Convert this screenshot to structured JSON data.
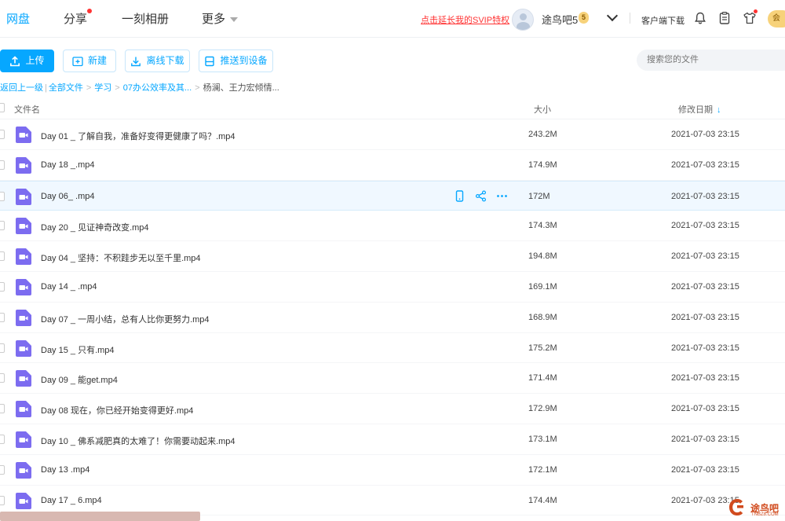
{
  "nav": {
    "tabs": [
      {
        "label": "网盘",
        "active": true
      },
      {
        "label": "分享",
        "badge_dot": true
      },
      {
        "label": "一刻相册"
      },
      {
        "label": "更多"
      }
    ],
    "svip_link": "点击延长我的SVIP特权",
    "username": "途鸟吧5",
    "vip_level": "5",
    "client_download": "客户端下载",
    "right_chip": "会"
  },
  "toolbar": {
    "upload": "上传",
    "new": "新建",
    "offline_download": "离线下载",
    "push_to_device": "推送到设备",
    "search_placeholder": "搜索您的文件"
  },
  "breadcrumb": {
    "back": "返回上一级",
    "items": [
      "全部文件",
      "学习",
      "07办公效率及其...",
      "杨澜、王力宏倾情..."
    ]
  },
  "table": {
    "col_name": "文件名",
    "col_size": "大小",
    "col_date": "修改日期",
    "rows": [
      {
        "name": "Day 01 _ 了解自我，准备好变得更健康了吗？.mp4",
        "size": "243.2M",
        "date": "2021-07-03 23:15"
      },
      {
        "name": "Day 18 _.mp4",
        "size": "174.9M",
        "date": "2021-07-03 23:15"
      },
      {
        "name": "Day 06_ .mp4",
        "size": "172M",
        "date": "2021-07-03 23:15",
        "hover": true
      },
      {
        "name": "Day 20 _ 见证神奇改变.mp4",
        "size": "174.3M",
        "date": "2021-07-03 23:15"
      },
      {
        "name": "Day 04 _ 坚持：不积跬步无以至千里.mp4",
        "size": "194.8M",
        "date": "2021-07-03 23:15"
      },
      {
        "name": "Day 14 _ .mp4",
        "size": "169.1M",
        "date": "2021-07-03 23:15"
      },
      {
        "name": "Day 07 _ 一周小结，总有人比你更努力.mp4",
        "size": "168.9M",
        "date": "2021-07-03 23:15"
      },
      {
        "name": "Day 15 _ 只有.mp4",
        "size": "175.2M",
        "date": "2021-07-03 23:15"
      },
      {
        "name": "Day 09 _ 能get.mp4",
        "size": "171.4M",
        "date": "2021-07-03 23:15"
      },
      {
        "name": "Day 08 现在，你已经开始变得更好.mp4",
        "size": "172.9M",
        "date": "2021-07-03 23:15"
      },
      {
        "name": "Day 10 _ 佛系减肥真的太难了！你需要动起来.mp4",
        "size": "173.1M",
        "date": "2021-07-03 23:15"
      },
      {
        "name": "Day 13 .mp4",
        "size": "172.1M",
        "date": "2021-07-03 23:15"
      },
      {
        "name": "Day 17 _ 6.mp4",
        "size": "174.4M",
        "date": "2021-07-03 23:15"
      }
    ]
  },
  "watermark": {
    "text": "途鸟吧",
    "sub": "TNBZ8.COM"
  },
  "colors": {
    "accent": "#06a7ff",
    "video_icon": "#7c6cf0",
    "alert": "#ff3333"
  }
}
